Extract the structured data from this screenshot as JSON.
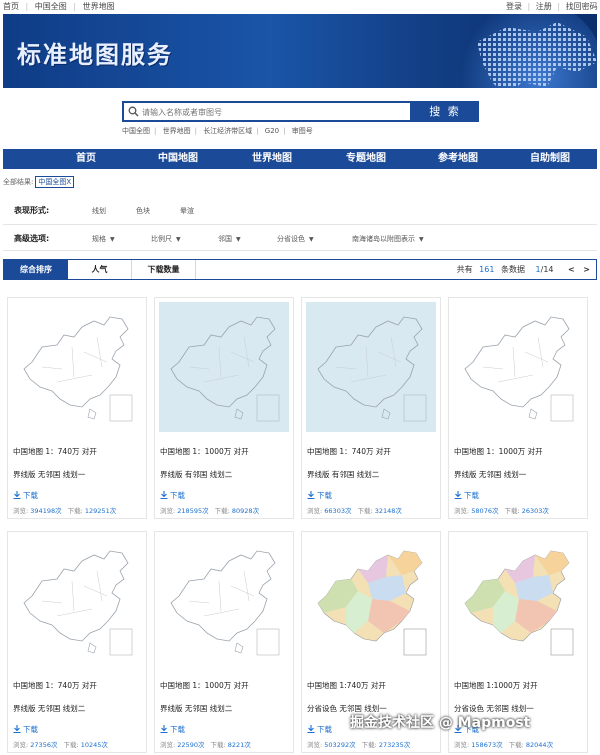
{
  "topbar": {
    "left": [
      "首页",
      "中国全图",
      "世界地图"
    ],
    "right": [
      "登录",
      "注册",
      "找回密码"
    ]
  },
  "banner": {
    "title": "标准地图服务"
  },
  "search": {
    "placeholder": "请输入名称或者审图号",
    "button": "搜 索"
  },
  "quick_links": [
    "中国全图",
    "世界地图",
    "长江经济带区域",
    "G20",
    "审图号"
  ],
  "nav": [
    "首页",
    "中国地图",
    "世界地图",
    "专题地图",
    "参考地图",
    "自助制图"
  ],
  "breadcrumb": {
    "label": "全部结果:",
    "tag": "中国全图X"
  },
  "filters": {
    "form_label": "表现形式:",
    "form_options": [
      "线划",
      "色块",
      "晕渲"
    ],
    "adv_label": "高级选项:",
    "adv_options": [
      "规格",
      "比例尺",
      "邻国",
      "分省设色",
      "南海诸岛以附图表示"
    ]
  },
  "sort": {
    "tabs": [
      "综合排序",
      "人气",
      "下载数量"
    ],
    "total_prefix": "共有",
    "total": "161",
    "total_suffix": "条数据",
    "page": "1",
    "pages": "/14",
    "prev": "<",
    "next": ">"
  },
  "cards": [
    {
      "t1": "中国地图 1：740万 对开",
      "t2": "界线版 无邻国 线划一",
      "dl": "下载",
      "views_label": "浏览:",
      "views": "394198次",
      "downloads_label": "下载:",
      "downloads": "129251次",
      "style": "line"
    },
    {
      "t1": "中国地图 1：1000万 对开",
      "t2": "界线版 有邻国 线划二",
      "dl": "下载",
      "views_label": "浏览:",
      "views": "218595次",
      "downloads_label": "下载:",
      "downloads": "80928次",
      "style": "neighbor"
    },
    {
      "t1": "中国地图 1：740万 对开",
      "t2": "界线版 有邻国 线划二",
      "dl": "下载",
      "views_label": "浏览:",
      "views": "66303次",
      "downloads_label": "下载:",
      "downloads": "32148次",
      "style": "neighbor"
    },
    {
      "t1": "中国地图 1：1000万 对开",
      "t2": "界线版 无邻国 线划一",
      "dl": "下载",
      "views_label": "浏览:",
      "views": "58076次",
      "downloads_label": "下载:",
      "downloads": "26303次",
      "style": "line"
    },
    {
      "t1": "中国地图 1：740万 对开",
      "t2": "界线版 无邻国 线划二",
      "dl": "下载",
      "views_label": "浏览:",
      "views": "27356次",
      "downloads_label": "下载:",
      "downloads": "10245次",
      "style": "line"
    },
    {
      "t1": "中国地图 1：1000万 对开",
      "t2": "界线版 无邻国 线划二",
      "dl": "下载",
      "views_label": "浏览:",
      "views": "22590次",
      "downloads_label": "下载:",
      "downloads": "8221次",
      "style": "line"
    },
    {
      "t1": "中国地图 1:740万 对开",
      "t2": "分省设色 无邻国 线划一",
      "dl": "下载",
      "views_label": "浏览:",
      "views": "503292次",
      "downloads_label": "下载:",
      "downloads": "273235次",
      "style": "color"
    },
    {
      "t1": "中国地图 1:1000万 对开",
      "t2": "分省设色 无邻国 线划一",
      "dl": "下载",
      "views_label": "浏览:",
      "views": "158673次",
      "downloads_label": "下载:",
      "downloads": "82044次",
      "style": "color"
    }
  ],
  "watermark": "掘金技术社区 @ Mapmost"
}
